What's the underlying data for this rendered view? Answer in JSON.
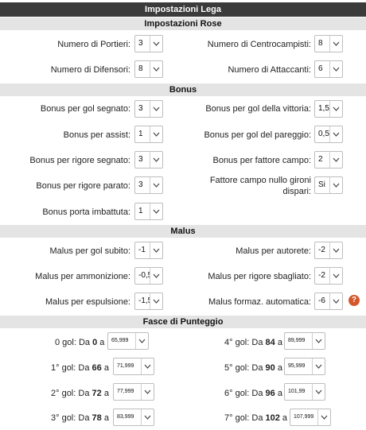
{
  "title": "Impostazioni Lega",
  "sections": {
    "rose": "Impostazioni Rose",
    "bonus": "Bonus",
    "malus": "Malus",
    "fasce": "Fasce di Punteggio"
  },
  "rose": {
    "portieri": {
      "label": "Numero di Portieri:",
      "value": "3"
    },
    "centrocampisti": {
      "label": "Numero di Centrocampisti:",
      "value": "8"
    },
    "difensori": {
      "label": "Numero di Difensori:",
      "value": "8"
    },
    "attaccanti": {
      "label": "Numero di Attaccanti:",
      "value": "6"
    }
  },
  "bonus": {
    "gol_segnato": {
      "label": "Bonus per gol segnato:",
      "value": "3"
    },
    "gol_vittoria": {
      "label": "Bonus per gol della vittoria:",
      "value": "1,5"
    },
    "assist": {
      "label": "Bonus per assist:",
      "value": "1"
    },
    "gol_pareggio": {
      "label": "Bonus per gol del pareggio:",
      "value": "0,5"
    },
    "rigore_segnato": {
      "label": "Bonus per rigore segnato:",
      "value": "3"
    },
    "fattore_campo": {
      "label": "Bonus per fattore campo:",
      "value": "2"
    },
    "rigore_parato": {
      "label": "Bonus per rigore parato:",
      "value": "3"
    },
    "fattore_nullo_line1": "Fattore campo nullo gironi",
    "fattore_nullo_line2": "dispari:",
    "fattore_nullo_value": "Si",
    "porta_imbattuta": {
      "label": "Bonus porta imbattuta:",
      "value": "1"
    }
  },
  "malus": {
    "gol_subito": {
      "label": "Malus per gol subito:",
      "value": "-1"
    },
    "autorete": {
      "label": "Malus per autorete:",
      "value": "-2"
    },
    "ammonizione": {
      "label": "Malus per ammonizione:",
      "value": "-0,5"
    },
    "rigore_sbagliato": {
      "label": "Malus per rigore sbagliato:",
      "value": "-2"
    },
    "espulsione": {
      "label": "Malus per espulsione:",
      "value": "-1,5"
    },
    "formaz_automatica": {
      "label": "Malus formaz. automatica:",
      "value": "-6"
    },
    "help_icon": "?"
  },
  "fasce": {
    "da_word": "Da",
    "a_word": "a",
    "rows": [
      {
        "gol": "0 gol:",
        "from": "0",
        "to": "65,999"
      },
      {
        "gol": "4° gol:",
        "from": "84",
        "to": "89,999"
      },
      {
        "gol": "1° gol:",
        "from": "66",
        "to": "71,999"
      },
      {
        "gol": "5° gol:",
        "from": "90",
        "to": "95,999"
      },
      {
        "gol": "2° gol:",
        "from": "72",
        "to": "77,999"
      },
      {
        "gol": "6° gol:",
        "from": "96",
        "to": "101,99"
      },
      {
        "gol": "3° gol:",
        "from": "78",
        "to": "83,999"
      },
      {
        "gol": "7° gol:",
        "from": "102",
        "to": "107,999"
      }
    ]
  },
  "icons": {
    "dropdown": "chevron-down-icon",
    "help": "help-icon"
  },
  "colors": {
    "title_bg": "#3b3b3b",
    "section_bg": "#e4e4e4",
    "help": "#d4572b"
  }
}
